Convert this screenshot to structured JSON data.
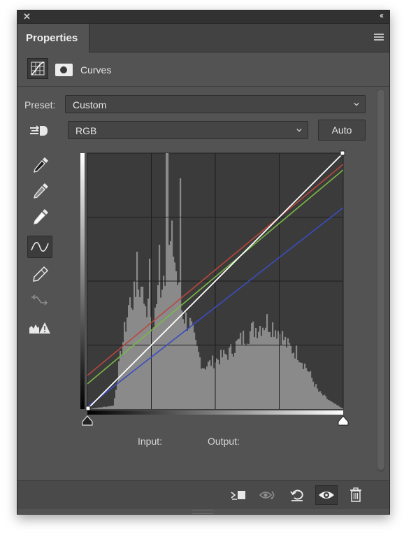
{
  "panel": {
    "tab_label": "Properties",
    "adjustment_label": "Curves"
  },
  "preset": {
    "label": "Preset:",
    "value": "Custom"
  },
  "channel": {
    "value": "RGB"
  },
  "auto_button": "Auto",
  "readout": {
    "input_label": "Input:",
    "output_label": "Output:"
  },
  "icons": {
    "close": "close-icon",
    "collapse": "double-chevron-left-icon",
    "panel_menu": "hamburger-menu-icon",
    "adjustment": "curves-adjustment-icon",
    "mask": "layer-mask-icon",
    "on_image_adjust": "targeted-adjustment-hand-icon",
    "tools": [
      "black-point-eyedropper-icon",
      "gray-point-eyedropper-icon",
      "white-point-eyedropper-icon",
      "curve-point-icon",
      "pencil-icon",
      "smooth-curve-icon",
      "clipping-warning-icon"
    ],
    "footer": [
      "clip-to-layer-icon",
      "view-previous-state-icon",
      "reset-icon",
      "visibility-eye-icon",
      "trash-icon"
    ]
  },
  "colors": {
    "panel_bg": "#535353",
    "graph_bg": "#3b3b3b",
    "histogram": "#8a8a8a",
    "red_curve": "#b8473c",
    "green_curve": "#79b847",
    "blue_curve": "#3b4cc0",
    "composite_curve": "#ffffff"
  }
}
